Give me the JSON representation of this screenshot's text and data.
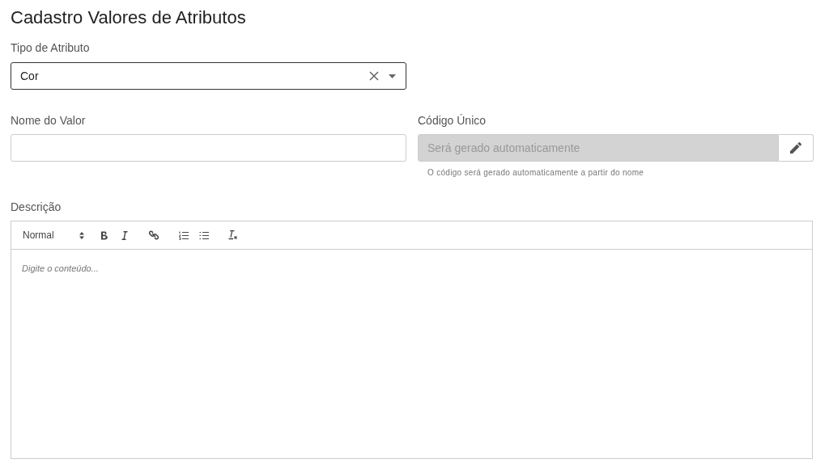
{
  "title": "Cadastro Valores de Atributos",
  "tipo": {
    "label": "Tipo de Atributo",
    "value": "Cor"
  },
  "nome": {
    "label": "Nome do Valor"
  },
  "codigo": {
    "label": "Código Único",
    "placeholder": "Será gerado automaticamente",
    "disabled": true,
    "hint": "O código será gerado automaticamente a partir do nome"
  },
  "descricao": {
    "label": "Descrição",
    "format": "Normal",
    "placeholder": "Digite o conteúdo..."
  }
}
